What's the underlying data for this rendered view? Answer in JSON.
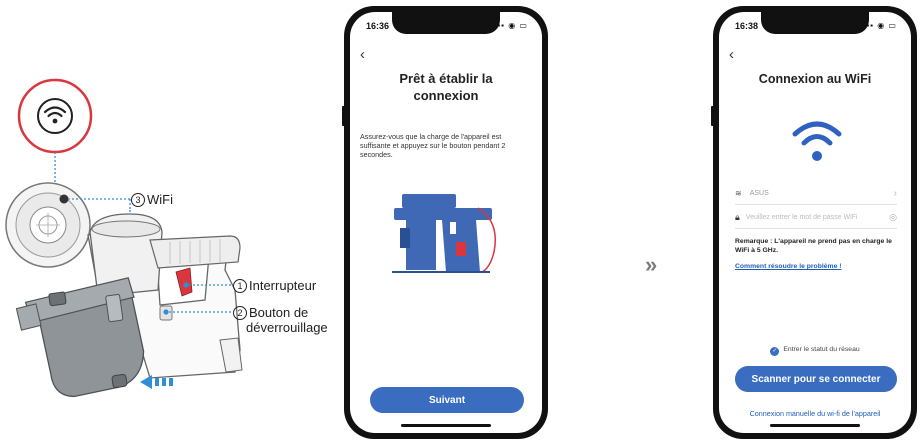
{
  "diagram": {
    "labels": {
      "wifi": "WiFi",
      "switch": "Interrupteur",
      "unlock_line1": "Bouton de",
      "unlock_line2": "déverrouillage"
    },
    "numbers": {
      "wifi": "3",
      "switch": "1",
      "unlock": "2"
    },
    "colors": {
      "accent_red": "#d9363e",
      "callout_line": "#2f8fd6",
      "device_grey": "#8f9499"
    }
  },
  "separator": {
    "symbol": "»"
  },
  "phone1": {
    "status_time": "16:36",
    "title_line1": "Prêt à établir la",
    "title_line2": "connexion",
    "instruction": "Assurez-vous que la charge de l'appareil est suffisante et appuyez sur le bouton pendant 2 secondes.",
    "next_button": "Suivant"
  },
  "phone2": {
    "status_time": "16:38",
    "title": "Connexion au WiFi",
    "network_name": "ASUS",
    "password_placeholder": "Veuillez entrer le mot de passe WiFi",
    "note": "Remarque : L'appareil ne prend pas en charge le WiFi à 5 GHz.",
    "help_link": "Comment résoudre le problème !",
    "status_check": "Entrer le statut du réseau",
    "scan_button": "Scanner pour se connecter",
    "manual_link": "Connexion manuelle du wi-fi de l'appareil"
  },
  "colors": {
    "primary": "#3a6dc0",
    "link": "#1f5eb8"
  }
}
